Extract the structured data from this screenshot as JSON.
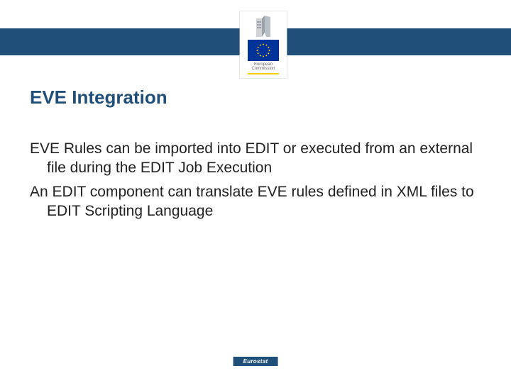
{
  "header": {
    "logo_label": "European\nCommission"
  },
  "slide": {
    "title": "EVE Integration",
    "para1": "EVE Rules can be imported into EDIT or executed from an external file during the EDIT Job Execution",
    "para2": "An EDIT component can translate EVE rules defined in XML files to EDIT Scripting Language"
  },
  "footer": {
    "label": "Eurostat"
  }
}
